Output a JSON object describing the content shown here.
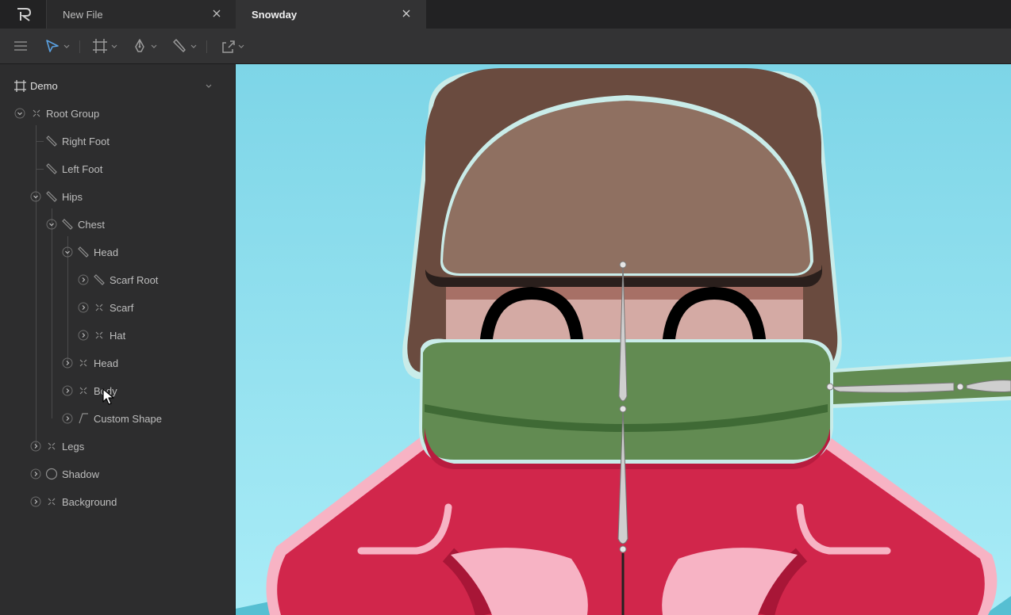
{
  "tabs": [
    {
      "label": "New File",
      "active": false
    },
    {
      "label": "Snowday",
      "active": true
    }
  ],
  "toolbar": {
    "tools": [
      "menu-icon",
      "select-tool-icon",
      "artboard-tool-icon",
      "pen-tool-icon",
      "bone-tool-icon",
      "export-icon"
    ]
  },
  "sidebar": {
    "artboard": "Demo",
    "tree": [
      {
        "label": "Root Group",
        "type": "group",
        "expanded": true
      },
      {
        "label": "Right Foot",
        "type": "bone"
      },
      {
        "label": "Left Foot",
        "type": "bone"
      },
      {
        "label": "Hips",
        "type": "bone",
        "expanded": true
      },
      {
        "label": "Chest",
        "type": "bone",
        "expanded": true
      },
      {
        "label": "Head",
        "type": "bone",
        "expanded": true
      },
      {
        "label": "Scarf Root",
        "type": "bone",
        "expanded": false
      },
      {
        "label": "Scarf",
        "type": "group",
        "expanded": false
      },
      {
        "label": "Hat",
        "type": "group",
        "expanded": false
      },
      {
        "label": "Head",
        "type": "group",
        "expanded": false
      },
      {
        "label": "Body",
        "type": "group",
        "expanded": false
      },
      {
        "label": "Custom Shape",
        "type": "path",
        "expanded": false
      },
      {
        "label": "Legs",
        "type": "group",
        "expanded": false
      },
      {
        "label": "Shadow",
        "type": "ellipse",
        "expanded": false
      },
      {
        "label": "Background",
        "type": "group",
        "expanded": false
      }
    ]
  },
  "colors": {
    "accent": "#5aa0e0",
    "sky": "#8fdcec",
    "hat": "#6a4b3f",
    "hat_inner": "#8f7061",
    "face": "#d4aaa4",
    "scarf": "#628b52",
    "coat": "#d1264b"
  }
}
